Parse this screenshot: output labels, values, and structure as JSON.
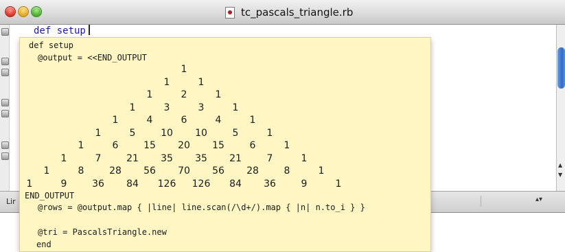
{
  "window": {
    "title": "tc_pascals_triangle.rb"
  },
  "editor": {
    "visible_line": "def setup"
  },
  "statusbar": {
    "label": "Lir"
  },
  "tooltip": {
    "code_lines": {
      "def_setup": "def setup",
      "output_assign": "@output = <<END_OUTPUT",
      "end_output": "END_OUTPUT",
      "rows_line": "@rows = @output.map { |line| line.scan(/\\d+/).map { |n| n.to_i } }",
      "tri_line": "@tri = PascalsTriangle.new",
      "end_kw": "end"
    },
    "triangle_rows": [
      [
        "1"
      ],
      [
        "1",
        "1"
      ],
      [
        "1",
        "2",
        "1"
      ],
      [
        "1",
        "3",
        "3",
        "1"
      ],
      [
        "1",
        "4",
        "6",
        "4",
        "1"
      ],
      [
        "1",
        "5",
        "10",
        "10",
        "5",
        "1"
      ],
      [
        "1",
        "6",
        "15",
        "20",
        "15",
        "6",
        "1"
      ],
      [
        "1",
        "7",
        "21",
        "35",
        "35",
        "21",
        "7",
        "1"
      ],
      [
        "1",
        "8",
        "28",
        "56",
        "70",
        "56",
        "28",
        "8",
        "1"
      ],
      [
        "1",
        "9",
        "36",
        "84",
        "126",
        "126",
        "84",
        "36",
        "9",
        "1"
      ]
    ]
  },
  "colors": {
    "tooltip_bg": "#fff6c4",
    "keyword_blue": "#1a1aa8",
    "scroll_thumb": "#2e6cc8"
  },
  "icons": {
    "close": "close-button-icon",
    "minimize": "minimize-button-icon",
    "zoom": "zoom-button-icon",
    "document": "ruby-document-icon",
    "fold": "fold-marker-icon"
  }
}
